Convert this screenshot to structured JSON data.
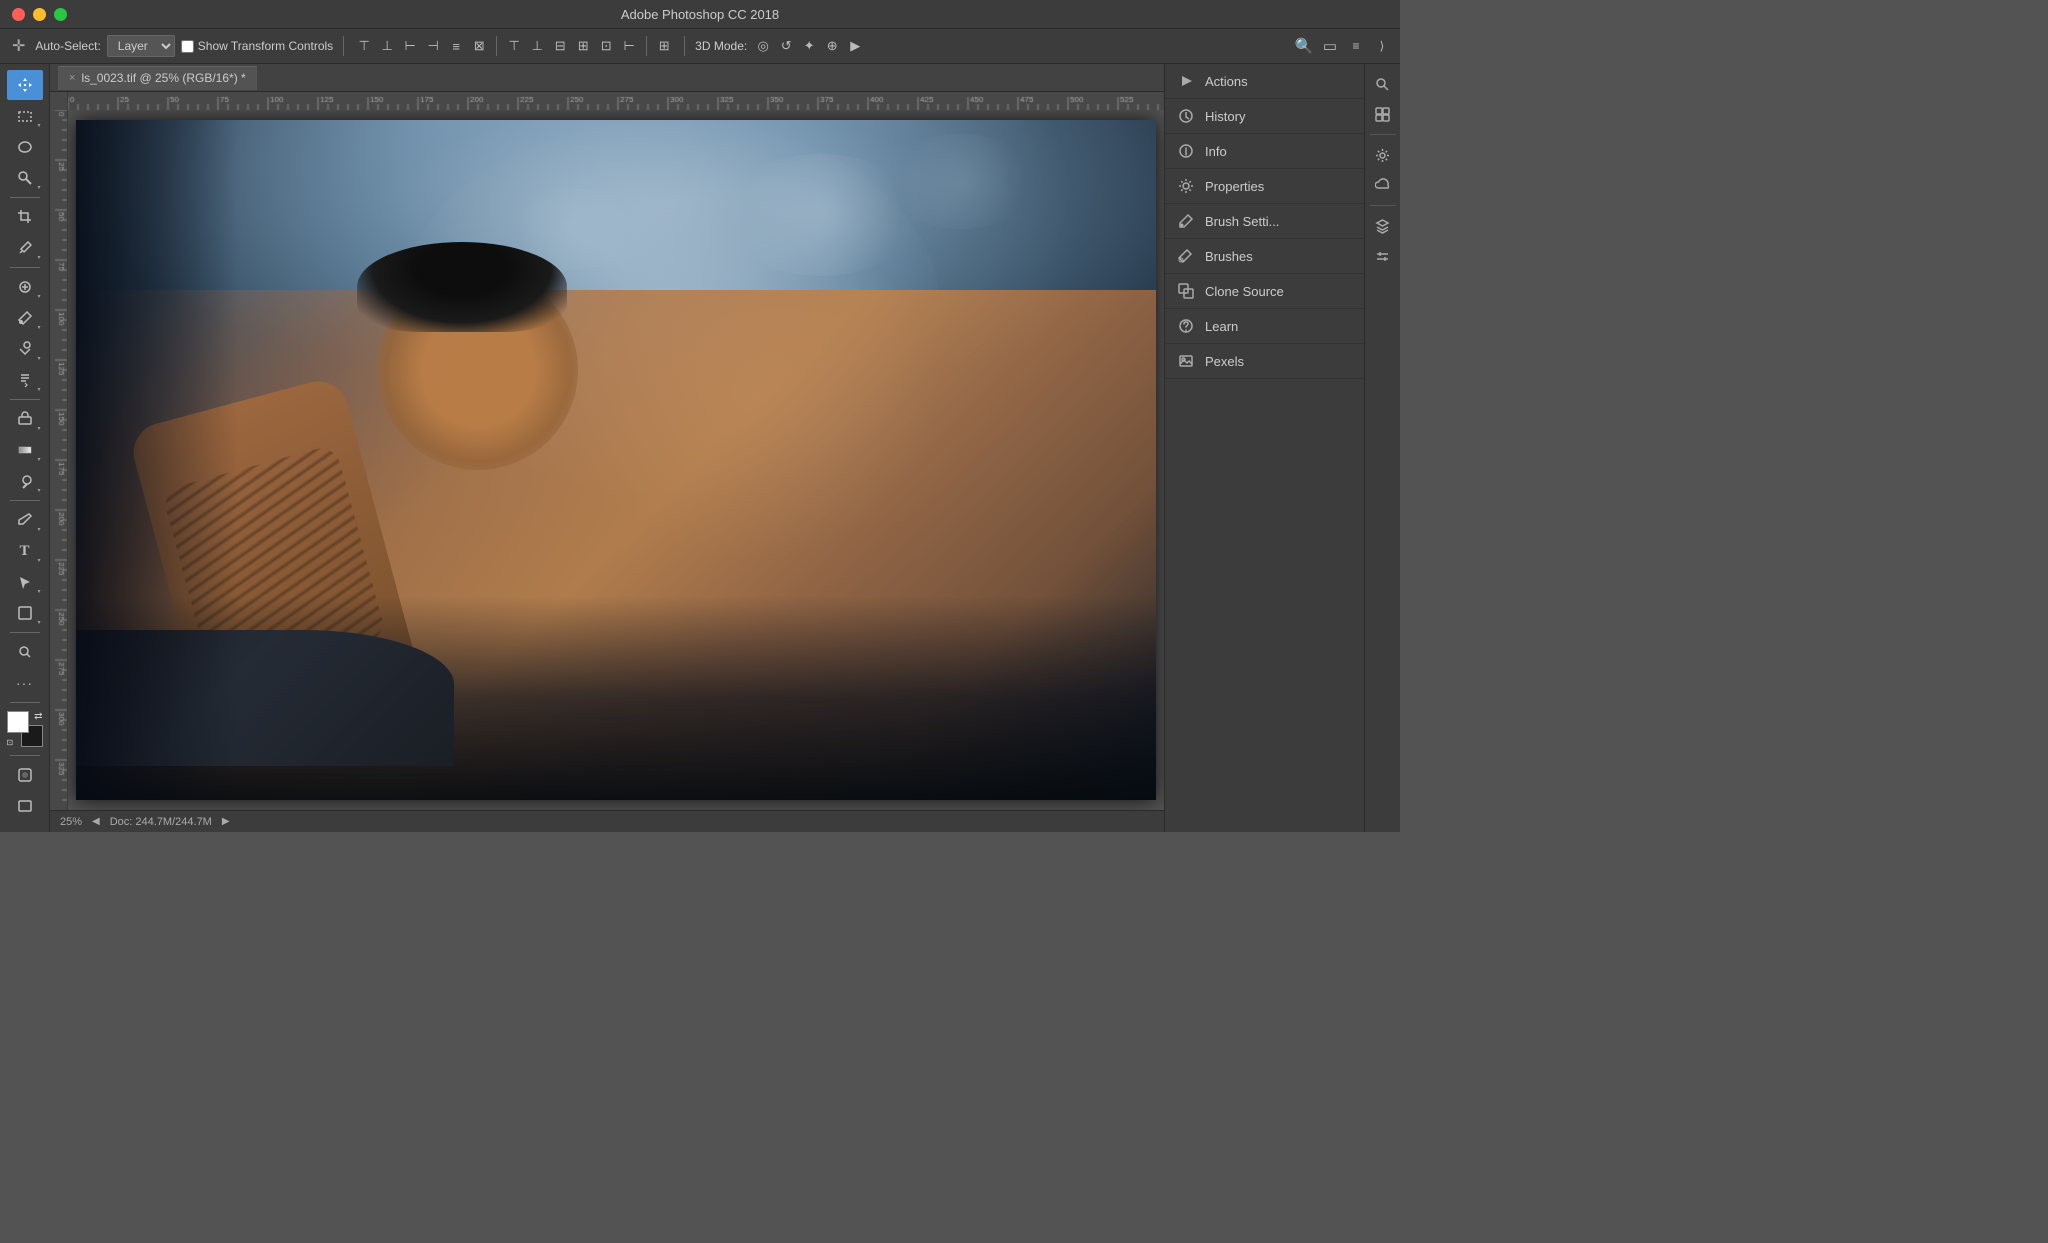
{
  "app": {
    "title": "Adobe Photoshop CC 2018",
    "window_controls": {
      "close": "●",
      "minimize": "●",
      "maximize": "●"
    }
  },
  "options_bar": {
    "tool_icon": "✛",
    "auto_select_label": "Auto-Select:",
    "layer_dropdown": "Layer",
    "show_transform_label": "Show Transform Controls",
    "align_icons": [
      "⊞",
      "⊟",
      "⊠",
      "⊡",
      "⊢",
      "⊣"
    ],
    "mode_label": "3D Mode:",
    "mode_icons": [
      "◎",
      "↺",
      "✦",
      "⊕",
      "▶"
    ]
  },
  "tab": {
    "close": "×",
    "filename": "ls_0023.tif @ 25% (RGB/16*) *"
  },
  "canvas": {
    "zoom": "25%",
    "doc_info": "Doc: 244.7M/244.7M"
  },
  "left_toolbar": {
    "tools": [
      {
        "id": "move",
        "icon": "✛",
        "active": true
      },
      {
        "id": "select-rect",
        "icon": "▭",
        "has_sub": true
      },
      {
        "id": "lasso",
        "icon": "⬡",
        "has_sub": false
      },
      {
        "id": "magic-wand",
        "icon": "✦",
        "has_sub": true
      },
      {
        "id": "crop",
        "icon": "⊡",
        "has_sub": false
      },
      {
        "id": "eyedropper",
        "icon": "✏",
        "has_sub": true
      },
      {
        "id": "heal",
        "icon": "🩹",
        "has_sub": true
      },
      {
        "id": "brush",
        "icon": "🖌",
        "has_sub": true
      },
      {
        "id": "clone-stamp",
        "icon": "⊕",
        "has_sub": true
      },
      {
        "id": "history-brush",
        "icon": "↩",
        "has_sub": true
      },
      {
        "id": "eraser",
        "icon": "◻",
        "has_sub": true
      },
      {
        "id": "gradient",
        "icon": "▦",
        "has_sub": true
      },
      {
        "id": "dodge",
        "icon": "◐",
        "has_sub": true
      },
      {
        "id": "pen",
        "icon": "✒",
        "has_sub": true
      },
      {
        "id": "type",
        "icon": "T",
        "has_sub": true
      },
      {
        "id": "path-select",
        "icon": "↖",
        "has_sub": true
      },
      {
        "id": "shape",
        "icon": "□",
        "has_sub": true
      },
      {
        "id": "zoom",
        "icon": "🔍",
        "has_sub": false
      },
      {
        "id": "more",
        "icon": "⋯",
        "has_sub": false
      }
    ]
  },
  "right_panels": {
    "items": [
      {
        "id": "actions",
        "label": "Actions",
        "icon": "▶"
      },
      {
        "id": "history",
        "label": "History",
        "icon": "🕐"
      },
      {
        "id": "info",
        "label": "Info",
        "icon": "ℹ"
      },
      {
        "id": "properties",
        "label": "Properties",
        "icon": "⚙"
      },
      {
        "id": "brush-settings",
        "label": "Brush Setti...",
        "icon": "🖌"
      },
      {
        "id": "brushes",
        "label": "Brushes",
        "icon": "🖌"
      },
      {
        "id": "clone-source",
        "label": "Clone Source",
        "icon": "⊕"
      },
      {
        "id": "learn",
        "label": "Learn",
        "icon": "💡"
      },
      {
        "id": "pexels",
        "label": "Pexels",
        "icon": "📷"
      }
    ]
  },
  "right_strip": {
    "icons": [
      {
        "id": "search",
        "icon": "🔍"
      },
      {
        "id": "panel-arrange",
        "icon": "⊞"
      },
      {
        "id": "workspace",
        "icon": "◫"
      },
      {
        "id": "settings",
        "icon": "⚙"
      },
      {
        "id": "cloud",
        "icon": "☁"
      },
      {
        "id": "layers",
        "icon": "⊟"
      },
      {
        "id": "adjustments",
        "icon": "◑"
      }
    ]
  },
  "colors": {
    "bg_dark": "#3c3c3c",
    "bg_medium": "#535353",
    "bg_light": "#484848",
    "accent": "#4a90d9",
    "border": "#2a2a2a",
    "text_light": "#cccccc",
    "text_dim": "#aaaaaa",
    "ruler_bg": "#484848",
    "canvas_bg": "#535353"
  }
}
